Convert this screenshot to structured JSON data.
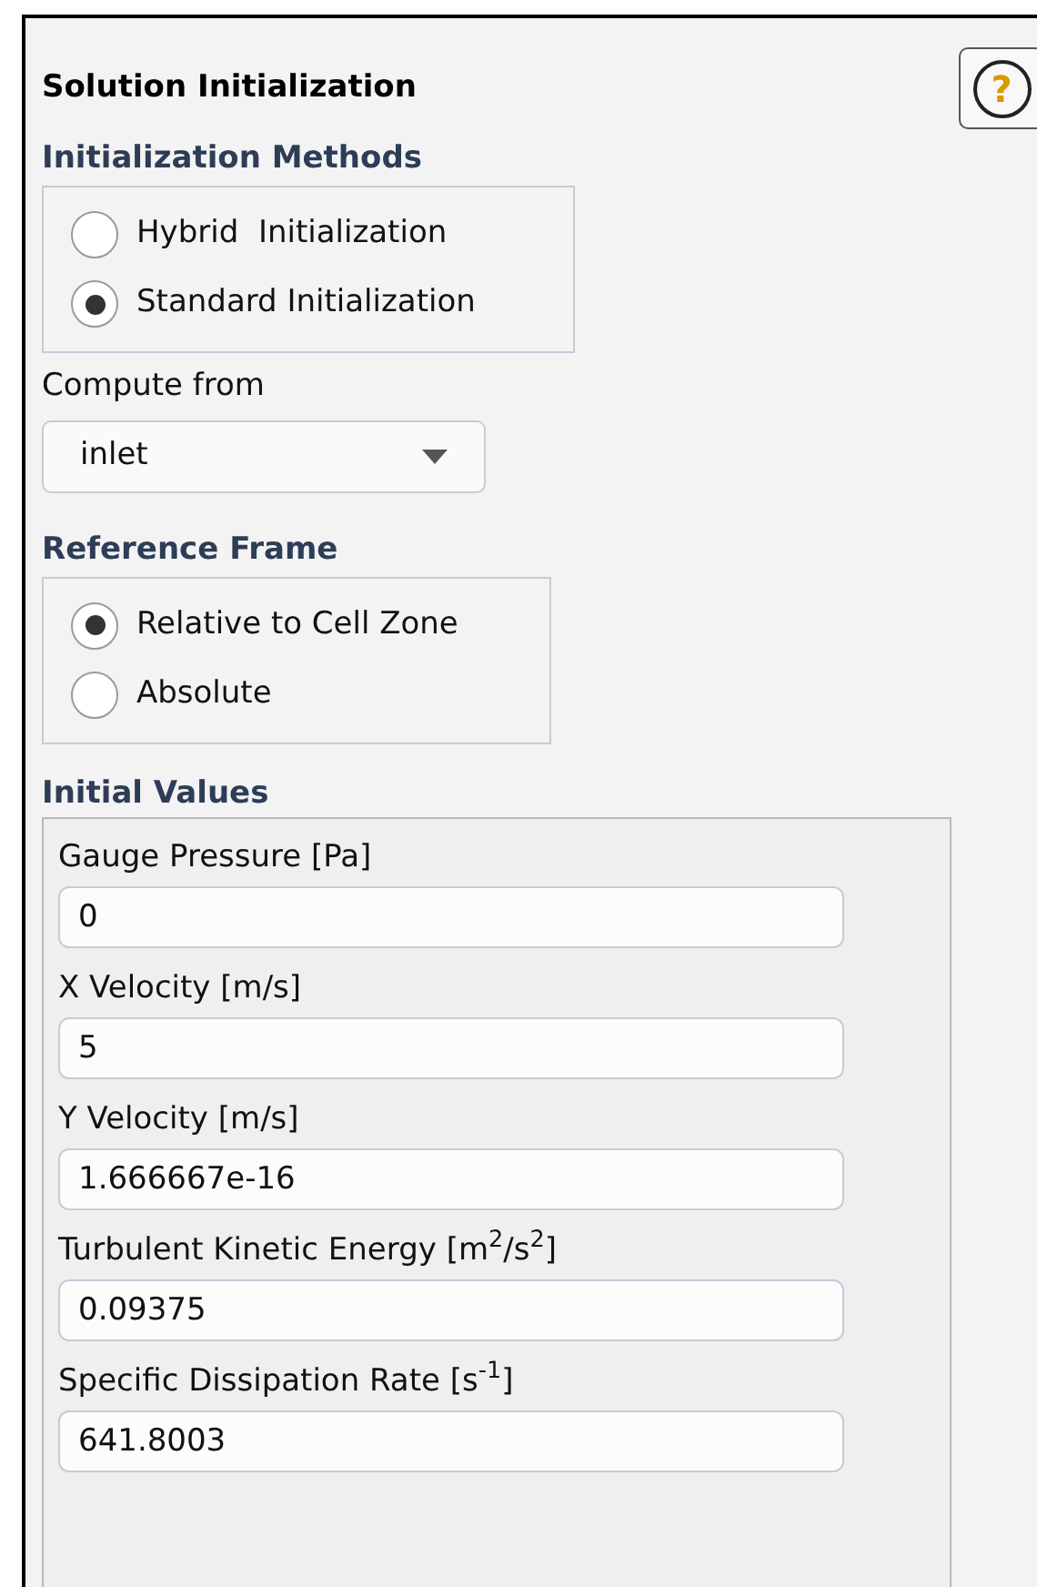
{
  "panel": {
    "title": "Solution Initialization",
    "help_button": "?"
  },
  "initialization_methods": {
    "heading": "Initialization Methods",
    "options": [
      {
        "label": "Hybrid  Initialization",
        "selected": false
      },
      {
        "label": "Standard Initialization",
        "selected": true
      }
    ]
  },
  "compute_from": {
    "label": "Compute from",
    "value": "inlet"
  },
  "reference_frame": {
    "heading": "Reference Frame",
    "options": [
      {
        "label": "Relative to Cell Zone",
        "selected": true
      },
      {
        "label": "Absolute",
        "selected": false
      }
    ]
  },
  "initial_values": {
    "heading": "Initial Values",
    "fields": [
      {
        "label": "Gauge Pressure [Pa]",
        "value": "0"
      },
      {
        "label": "X Velocity [m/s]",
        "value": "5"
      },
      {
        "label": "Y Velocity [m/s]",
        "value": "1.666667e-16"
      },
      {
        "label": "Turbulent Kinetic Energy [m$^{2}$/s$^{2}$]",
        "value": "0.09375"
      },
      {
        "label": "Specific Dissipation Rate [s$^{-1}$]",
        "value": "641.8003"
      }
    ]
  }
}
